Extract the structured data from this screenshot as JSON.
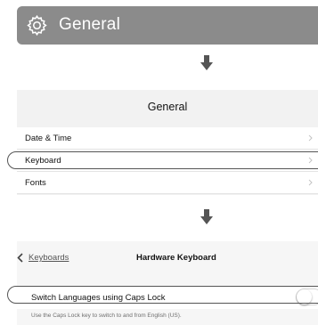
{
  "step1": {
    "title": "General",
    "icon": "gear-icon",
    "banner_color": "#8b8b8b"
  },
  "arrows": [
    "arrow-down-icon",
    "arrow-down-icon"
  ],
  "step2": {
    "header": "General",
    "items": [
      {
        "label": "Date & Time",
        "highlighted": false
      },
      {
        "label": "Keyboard",
        "highlighted": true
      },
      {
        "label": "Fonts",
        "highlighted": false
      }
    ]
  },
  "step3": {
    "back_label": "Keyboards",
    "title": "Hardware Keyboard",
    "switch": {
      "label": "Switch Languages using Caps Lock",
      "enabled": false
    },
    "hint": "Use the Caps Lock key to switch to and from English (US)."
  }
}
